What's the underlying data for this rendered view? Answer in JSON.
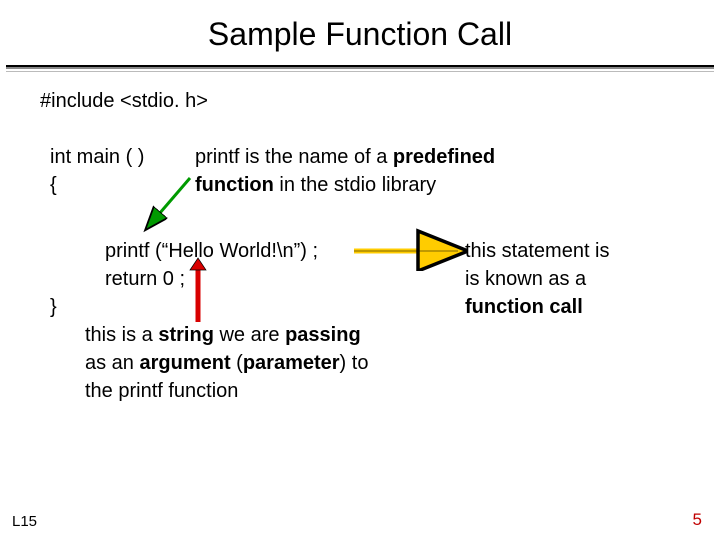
{
  "title": "Sample Function Call",
  "code": {
    "include": "#include <stdio. h>",
    "main_sig": "int main ( )",
    "brace_open": "{",
    "printf_call": "printf (“Hello World!\\n”) ;",
    "return_stmt": "return 0 ;",
    "brace_close": "}"
  },
  "notes": {
    "predefined_1": "printf is the name of a ",
    "predefined_bold": "predefined",
    "predefined_2a_bold": "function",
    "predefined_2b": " in the stdio library",
    "callout_1": "this statement is",
    "callout_2": "is known as a",
    "callout_3_bold": "function call",
    "string_1a": "this is a ",
    "string_1b_bold": "string",
    "string_1c": " we are ",
    "string_1d_bold": "passing",
    "string_2a": "as an ",
    "string_2b_bold": "argument",
    "string_2c": " (",
    "string_2d_bold": "parameter",
    "string_2e": ") to",
    "string_3": "the printf function"
  },
  "footer": {
    "left": "L15",
    "right": "5"
  }
}
